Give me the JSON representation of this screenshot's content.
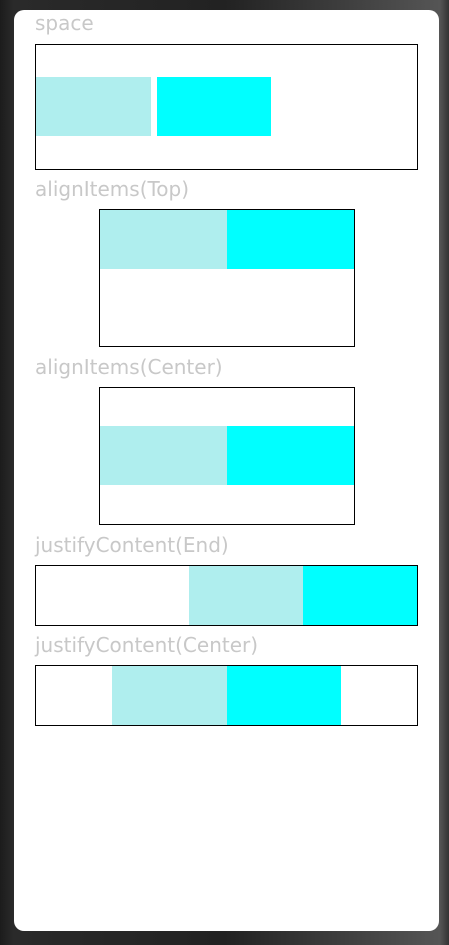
{
  "sections": [
    {
      "label": "space"
    },
    {
      "label": "alignItems(Top)"
    },
    {
      "label": "alignItems(Center)"
    },
    {
      "label": "justifyContent(End)"
    },
    {
      "label": "justifyContent(Center)"
    }
  ],
  "colors": {
    "item_1": "#afeeee",
    "item_2": "#00ffff",
    "border": "#000000",
    "label": "#c8c8c8"
  }
}
